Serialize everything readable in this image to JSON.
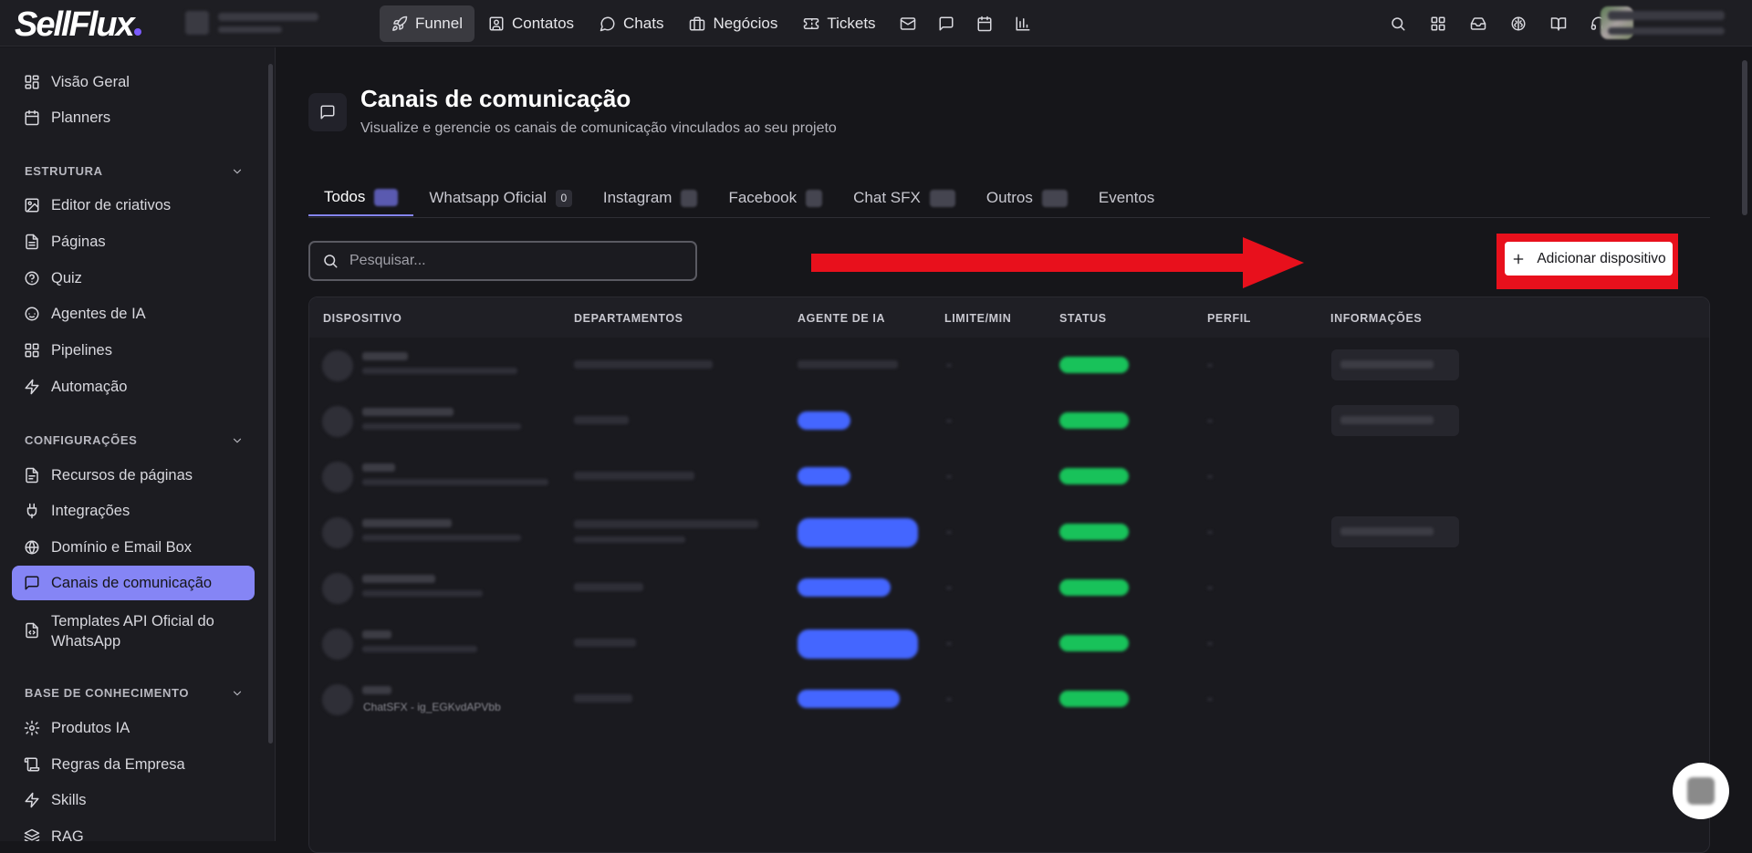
{
  "app": {
    "logo": "SellFlux"
  },
  "nav": {
    "items": [
      {
        "label": "Funnel",
        "icon": "rocket-icon"
      },
      {
        "label": "Contatos",
        "icon": "contacts-icon"
      },
      {
        "label": "Chats",
        "icon": "chat-icon"
      },
      {
        "label": "Negócios",
        "icon": "briefcase-icon"
      },
      {
        "label": "Tickets",
        "icon": "ticket-icon"
      }
    ],
    "active_index": 0
  },
  "sidebar": {
    "top_items": [
      {
        "label": "Visão Geral"
      },
      {
        "label": "Planners"
      }
    ],
    "sections": [
      {
        "title": "ESTRUTURA"
      },
      {
        "title": "CONFIGURAÇÕES"
      },
      {
        "title": "BASE DE CONHECIMENTO"
      }
    ],
    "estrutura_items": [
      {
        "label": "Editor de criativos"
      },
      {
        "label": "Páginas"
      },
      {
        "label": "Quiz"
      },
      {
        "label": "Agentes de IA"
      },
      {
        "label": "Pipelines"
      },
      {
        "label": "Automação"
      }
    ],
    "config_items": [
      {
        "label": "Recursos de páginas"
      },
      {
        "label": "Integrações"
      },
      {
        "label": "Domínio e Email Box"
      },
      {
        "label": "Canais de comunicação"
      },
      {
        "label": "Templates API Oficial do WhatsApp"
      }
    ],
    "kb_items": [
      {
        "label": "Produtos IA"
      },
      {
        "label": "Regras da Empresa"
      },
      {
        "label": "Skills"
      },
      {
        "label": "RAG"
      }
    ]
  },
  "page": {
    "title": "Canais de comunicação",
    "subtitle": "Visualize e gerencie os canais de comunicação vinculados ao seu projeto"
  },
  "tabs": [
    {
      "label": "Todos"
    },
    {
      "label": "Whatsapp Oficial",
      "count": "0"
    },
    {
      "label": "Instagram"
    },
    {
      "label": "Facebook"
    },
    {
      "label": "Chat SFX"
    },
    {
      "label": "Outros"
    },
    {
      "label": "Eventos"
    }
  ],
  "search": {
    "placeholder": "Pesquisar..."
  },
  "add_button": {
    "label": "Adicionar dispositivo"
  },
  "table": {
    "columns": [
      "DISPOSITIVO",
      "DEPARTAMENTOS",
      "AGENTE DE IA",
      "LIMITE/MIN",
      "STATUS",
      "PERFIL",
      "INFORMAÇÕES"
    ],
    "last_row_subtitle": "ChatSFX - ig_EGKvdAPVbb"
  },
  "colors": {
    "accent": "#8585f5",
    "highlight_red": "#e8101c",
    "status_green": "#18c25a",
    "agent_blue": "#4466ff"
  }
}
